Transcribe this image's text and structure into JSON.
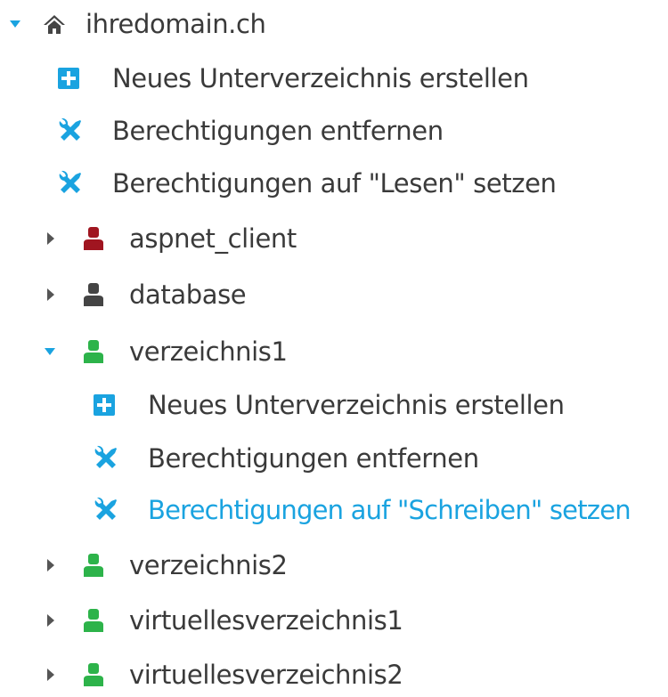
{
  "colors": {
    "text": "#3a3a3a",
    "link": "#1aa3e0",
    "toggle": "#1aa3e0",
    "collapsed_toggle": "#555555",
    "plus_bg": "#1aa3e0",
    "tools": "#1aa3e0",
    "user_red": "#a01520",
    "user_gray": "#444444",
    "user_green": "#2db34a",
    "home": "#444444"
  },
  "tree": {
    "root": {
      "label": "ihredomain.ch",
      "icon": "home-icon",
      "expanded": true,
      "actions": [
        {
          "label": "Neues Unterverzeichnis erstellen",
          "icon": "plus-square-icon"
        },
        {
          "label": "Berechtigungen entfernen",
          "icon": "tools-icon"
        },
        {
          "label": "Berechtigungen auf \"Lesen\" setzen",
          "icon": "tools-icon"
        }
      ]
    },
    "children": [
      {
        "label": "aspnet_client",
        "icon": "user-icon",
        "status": "red",
        "expanded": false
      },
      {
        "label": "database",
        "icon": "user-icon",
        "status": "gray",
        "expanded": false
      },
      {
        "label": "verzeichnis1",
        "icon": "user-icon",
        "status": "green",
        "expanded": true,
        "actions": [
          {
            "label": "Neues Unterverzeichnis erstellen",
            "icon": "plus-square-icon"
          },
          {
            "label": "Berechtigungen entfernen",
            "icon": "tools-icon"
          },
          {
            "label": "Berechtigungen auf \"Schreiben\" setzen",
            "icon": "tools-icon",
            "highlighted": true
          }
        ]
      },
      {
        "label": "verzeichnis2",
        "icon": "user-icon",
        "status": "green",
        "expanded": false
      },
      {
        "label": "virtuellesverzeichnis1",
        "icon": "user-icon",
        "status": "green",
        "expanded": false
      },
      {
        "label": "virtuellesverzeichnis2",
        "icon": "user-icon",
        "status": "green",
        "expanded": false
      }
    ]
  }
}
